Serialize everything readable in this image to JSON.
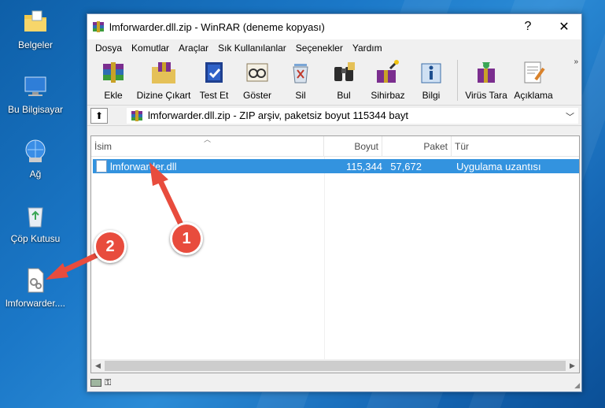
{
  "desktop": {
    "icons": [
      {
        "label": "Belgeler",
        "icon": "folder-icon"
      },
      {
        "label": "Bu Bilgisayar",
        "icon": "computer-icon"
      },
      {
        "label": "Ağ",
        "icon": "network-icon"
      },
      {
        "label": "Çöp Kutusu",
        "icon": "recycle-bin-icon"
      },
      {
        "label": "lmforwarder....",
        "icon": "dll-file-icon"
      }
    ]
  },
  "window": {
    "title": "lmforwarder.dll.zip - WinRAR (deneme kopyası)",
    "help": "?",
    "close": "✕",
    "menu": [
      "Dosya",
      "Komutlar",
      "Araçlar",
      "Sık Kullanılanlar",
      "Seçenekler",
      "Yardım"
    ],
    "toolbar": [
      {
        "label": "Ekle",
        "icon": "add-books-icon"
      },
      {
        "label": "Dizine Çıkart",
        "icon": "extract-folder-icon"
      },
      {
        "label": "Test Et",
        "icon": "test-book-icon"
      },
      {
        "label": "Göster",
        "icon": "view-glasses-icon"
      },
      {
        "label": "Sil",
        "icon": "delete-icon"
      },
      {
        "label": "Bul",
        "icon": "binoculars-icon"
      },
      {
        "label": "Sihirbaz",
        "icon": "wizard-icon"
      },
      {
        "label": "Bilgi",
        "icon": "info-icon"
      },
      {
        "label": "Virüs Tara",
        "icon": "virus-scan-icon"
      },
      {
        "label": "Açıklama",
        "icon": "comment-icon"
      }
    ],
    "toolbar_more": "»",
    "address": "lmforwarder.dll.zip - ZIP arşiv, paketsiz boyut 115344 bayt",
    "columns": {
      "name": "İsim",
      "size": "Boyut",
      "packed": "Paket",
      "type": "Tür"
    },
    "files": [
      {
        "name": "lmforwarder.dll",
        "size": "115,344",
        "packed": "57,672",
        "type": "Uygulama uzantısı"
      }
    ]
  },
  "annotations": {
    "badge1": "1",
    "badge2": "2",
    "color": "#e84c3d"
  }
}
